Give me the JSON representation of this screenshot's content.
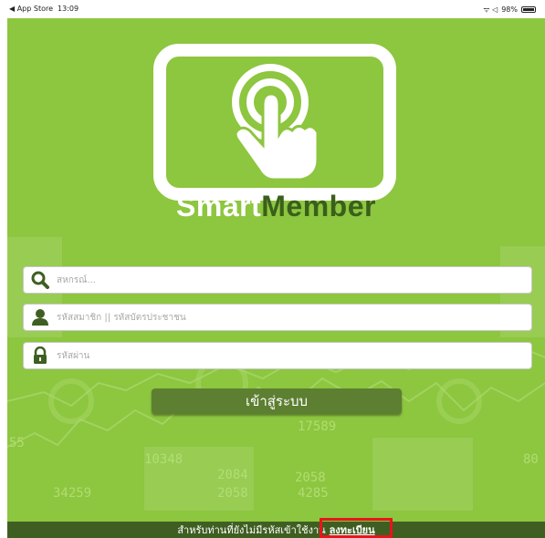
{
  "status_bar": {
    "back_app": "◀ App Store",
    "time": "13:09",
    "signal": "ᯤ ◁",
    "battery": "98%"
  },
  "brand": {
    "part1": "Smart",
    "part2": "Member",
    "icon": "touch-hand-icon"
  },
  "background_numbers": [
    "17589",
    "55",
    "10348",
    "2058",
    "4285",
    "2084",
    "2058",
    "34259",
    "80"
  ],
  "form": {
    "cooperative_placeholder": "สหกรณ์...",
    "member_placeholder": "รหัสสมาชิก || รหัสบัตรประชาชน",
    "password_placeholder": "รหัสผ่าน",
    "login_label": "เข้าสู่ระบบ"
  },
  "footer": {
    "prompt": "สำหรับท่านที่ยังไม่มีรหัสเข้าใช้งาน",
    "register_label": "ลงทะเบียน"
  },
  "colors": {
    "background": "#8dc63f",
    "brand_dark": "#3a5f1b",
    "button": "#5d7f31",
    "footer": "#3f5f22",
    "highlight": "#e8141b"
  }
}
